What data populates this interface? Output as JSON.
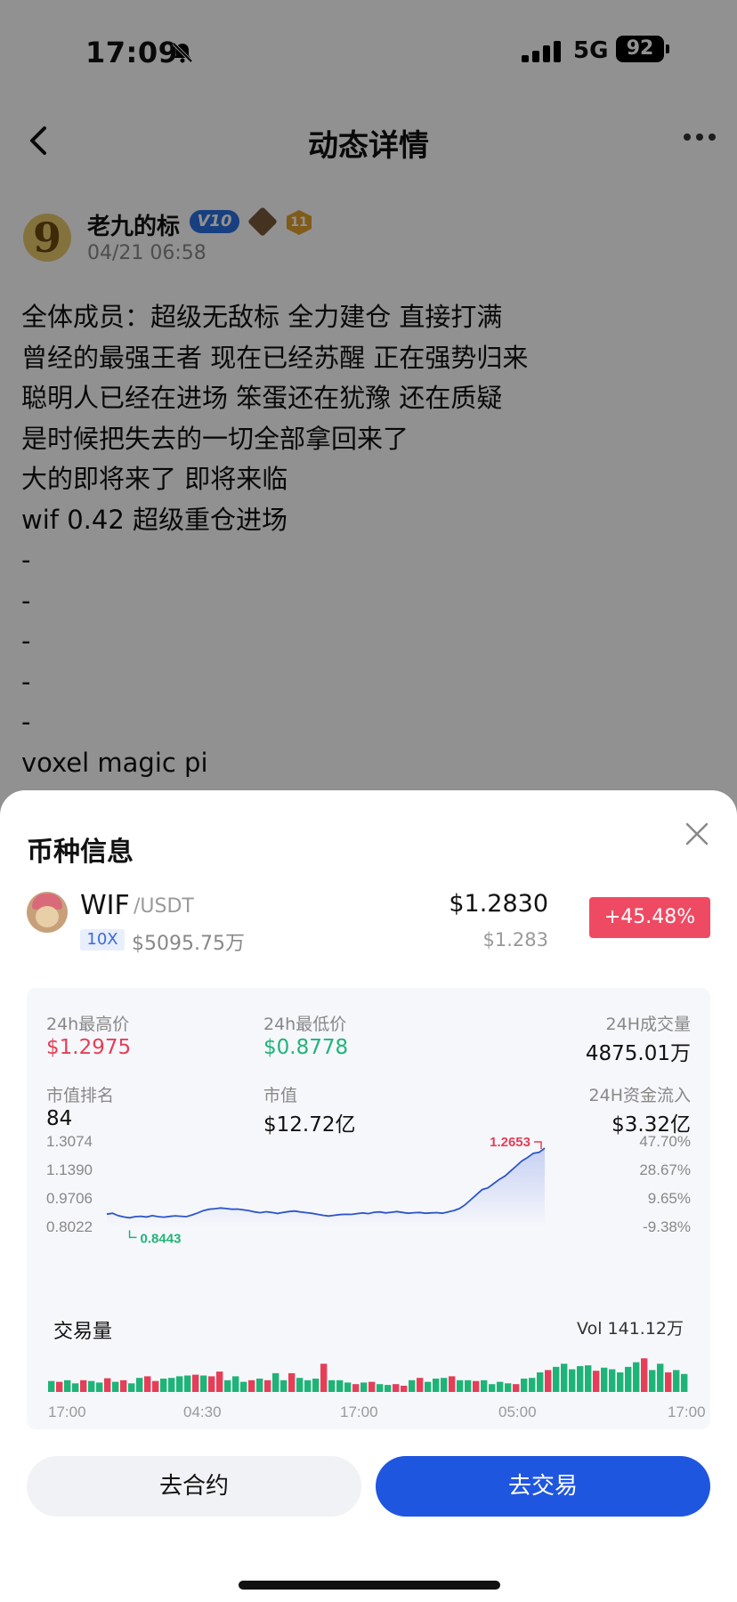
{
  "status_bar": {
    "time": "17:09",
    "network": "5G",
    "battery": "92"
  },
  "nav": {
    "title": "动态详情"
  },
  "post": {
    "author": "老九的标",
    "avatar_glyph": "9",
    "vip_level": "V10",
    "level_badge": "11",
    "time": "04/21 06:58",
    "lines": [
      "全体成员：超级无敌标 全力建仓 直接打满",
      "曾经的最强王者 现在已经苏醒 正在强势归来",
      "聪明人已经在进场 笨蛋还在犹豫 还在质疑",
      "是时候把失去的一切全部拿回来了",
      "大的即将来了 即将来临",
      "wif 0.42 超级重仓进场",
      "-",
      "-",
      "-",
      "-",
      "-",
      "voxel magic pi"
    ]
  },
  "sheet": {
    "title": "币种信息",
    "coin": {
      "symbol": "WIF",
      "quote": "/USDT",
      "leverage": "10X",
      "volume": "$5095.75万",
      "price": "$1.2830",
      "price_sub": "$1.283",
      "change": "+45.48%"
    },
    "stats": {
      "high_label": "24h最高价",
      "high_value": "$1.2975",
      "low_label": "24h最低价",
      "low_value": "$0.8778",
      "vol24_label": "24H成交量",
      "vol24_value": "4875.01万",
      "rank_label": "市值排名",
      "rank_value": "84",
      "mcap_label": "市值",
      "mcap_value": "$12.72亿",
      "inflow_label": "24H资金流入",
      "inflow_value": "$3.32亿"
    },
    "chart": {
      "y_labels": [
        "1.3074",
        "1.1390",
        "0.9706",
        "0.8022"
      ],
      "pct_labels": [
        "47.70%",
        "28.67%",
        "9.65%",
        "-9.38%"
      ],
      "max_marker": "1.2653",
      "min_marker": "0.8443"
    },
    "volume": {
      "title": "交易量",
      "total": "Vol 141.12万",
      "x_labels": [
        "17:00",
        "04:30",
        "17:00",
        "05:00",
        "17:00"
      ]
    },
    "buttons": {
      "contract": "去合约",
      "trade": "去交易"
    }
  },
  "colors": {
    "up": "#1fb477",
    "down": "#e63e58",
    "accent": "#1f56e0",
    "line": "#2d55c8"
  },
  "chart_data": {
    "type": "line",
    "ylim": [
      0.8022,
      1.3074
    ],
    "y_ticks": [
      1.3074,
      1.139,
      0.9706,
      0.8022
    ],
    "values": [
      0.875,
      0.88,
      0.866,
      0.858,
      0.853,
      0.86,
      0.862,
      0.858,
      0.866,
      0.86,
      0.857,
      0.861,
      0.865,
      0.862,
      0.86,
      0.87,
      0.882,
      0.896,
      0.904,
      0.907,
      0.911,
      0.908,
      0.904,
      0.905,
      0.9,
      0.896,
      0.888,
      0.883,
      0.889,
      0.885,
      0.879,
      0.885,
      0.89,
      0.893,
      0.888,
      0.884,
      0.88,
      0.874,
      0.868,
      0.864,
      0.868,
      0.872,
      0.874,
      0.873,
      0.878,
      0.882,
      0.878,
      0.886,
      0.888,
      0.882,
      0.886,
      0.89,
      0.885,
      0.88,
      0.883,
      0.885,
      0.88,
      0.882,
      0.884,
      0.88,
      0.888,
      0.896,
      0.908,
      0.93,
      0.96,
      0.99,
      1.02,
      1.03,
      1.055,
      1.08,
      1.1,
      1.13,
      1.16,
      1.19,
      1.21,
      1.235,
      1.24,
      1.265
    ],
    "max_label": "1.2653",
    "min_label": "0.8443"
  },
  "volume_data": {
    "up": [
      1,
      0,
      1,
      1,
      0,
      1,
      1,
      0,
      1,
      0,
      1,
      1,
      0,
      0,
      1,
      1,
      1,
      1,
      0,
      1,
      0,
      0,
      1,
      1,
      1,
      0,
      1,
      0,
      1,
      1,
      0,
      1,
      1,
      1,
      0,
      1,
      1,
      1,
      0,
      1,
      0,
      1,
      1,
      0,
      0,
      1,
      0,
      1,
      1,
      1,
      0,
      1,
      1,
      0,
      1,
      1,
      1,
      1,
      0,
      1,
      1,
      1,
      0,
      1,
      1,
      1,
      1,
      1,
      0,
      1,
      1,
      1,
      1,
      1,
      0,
      1,
      1,
      0,
      1,
      1
    ],
    "values": [
      0.28,
      0.26,
      0.3,
      0.22,
      0.3,
      0.28,
      0.24,
      0.35,
      0.26,
      0.3,
      0.22,
      0.36,
      0.4,
      0.28,
      0.34,
      0.36,
      0.4,
      0.42,
      0.44,
      0.42,
      0.4,
      0.52,
      0.3,
      0.4,
      0.26,
      0.3,
      0.34,
      0.3,
      0.48,
      0.3,
      0.48,
      0.36,
      0.3,
      0.34,
      0.72,
      0.3,
      0.3,
      0.24,
      0.2,
      0.24,
      0.26,
      0.2,
      0.18,
      0.2,
      0.16,
      0.3,
      0.36,
      0.26,
      0.34,
      0.36,
      0.4,
      0.3,
      0.3,
      0.28,
      0.3,
      0.2,
      0.26,
      0.22,
      0.2,
      0.34,
      0.36,
      0.5,
      0.56,
      0.64,
      0.72,
      0.58,
      0.66,
      0.68,
      0.54,
      0.62,
      0.58,
      0.5,
      0.64,
      0.76,
      0.86,
      0.56,
      0.72,
      0.5,
      0.56,
      0.46
    ]
  }
}
